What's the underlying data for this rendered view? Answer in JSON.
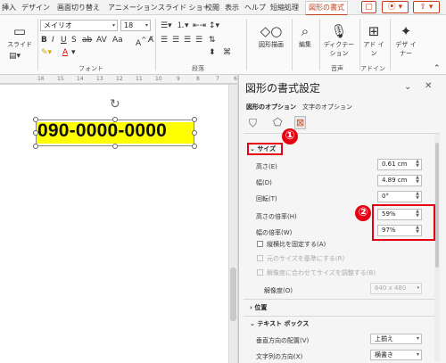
{
  "ribbon": {
    "tabs": [
      {
        "label": "挿入"
      },
      {
        "label": "デザイン"
      },
      {
        "label": "画面切り替え"
      },
      {
        "label": "アニメーション"
      },
      {
        "label": "スライド ショー"
      },
      {
        "label": "校閲"
      },
      {
        "label": "表示"
      },
      {
        "label": "ヘルプ"
      },
      {
        "label": "短縮処理"
      },
      {
        "label": "図形の書式"
      }
    ],
    "slide_button": "スライド",
    "font_name": "メイリオ",
    "font_size": "18",
    "font_group": "フォント",
    "paragraph_group": "段落",
    "drawing_button": "図形描画",
    "edit_button": "編集",
    "dictation_button": "ディクテーション",
    "voice_group": "音声",
    "addins_button": "アド イン",
    "addins_group": "アドイン",
    "designer_button": "デザ イナー"
  },
  "ruler": {
    "marks": [
      "16",
      "15",
      "14",
      "13",
      "12",
      "11",
      "10",
      "9",
      "8",
      "7",
      "6"
    ]
  },
  "slide": {
    "textbox_text": "090-0000-0000"
  },
  "pane": {
    "title": "図形の書式設定",
    "tabs": {
      "shape_options": "図形のオプション",
      "text_options": "文字のオプション"
    },
    "size_section": "サイズ",
    "fields": {
      "height": {
        "label": "高さ(E)",
        "value": "0.61 cm"
      },
      "width": {
        "label": "幅(D)",
        "value": "4.89 cm"
      },
      "rotation": {
        "label": "回転(T)",
        "value": "0°"
      },
      "height_scale": {
        "label": "高さの倍率(H)",
        "value": "59%"
      },
      "width_scale": {
        "label": "幅の倍率(W)",
        "value": "97%"
      }
    },
    "lock_aspect": "縦横比を固定する(A)",
    "relative_original": "元のサイズを基準にする(R)",
    "best_scale": "解像度に合わせてサイズを調整する(B)",
    "resolution": {
      "label": "解像度(O)",
      "value": "640 x 480"
    },
    "position_section": "位置",
    "textbox_section": "テキスト ボックス",
    "vertical_align": {
      "label": "垂直方向の配置(V)",
      "value": "上揃え"
    },
    "text_direction": {
      "label": "文字列の方向(X)",
      "value": "横書き"
    }
  },
  "annotations": {
    "badge1": "①",
    "badge2": "②"
  },
  "colors": {
    "accent": "#c43e1c",
    "annotation_red": "#e60012",
    "highlight": "#ffff00"
  }
}
